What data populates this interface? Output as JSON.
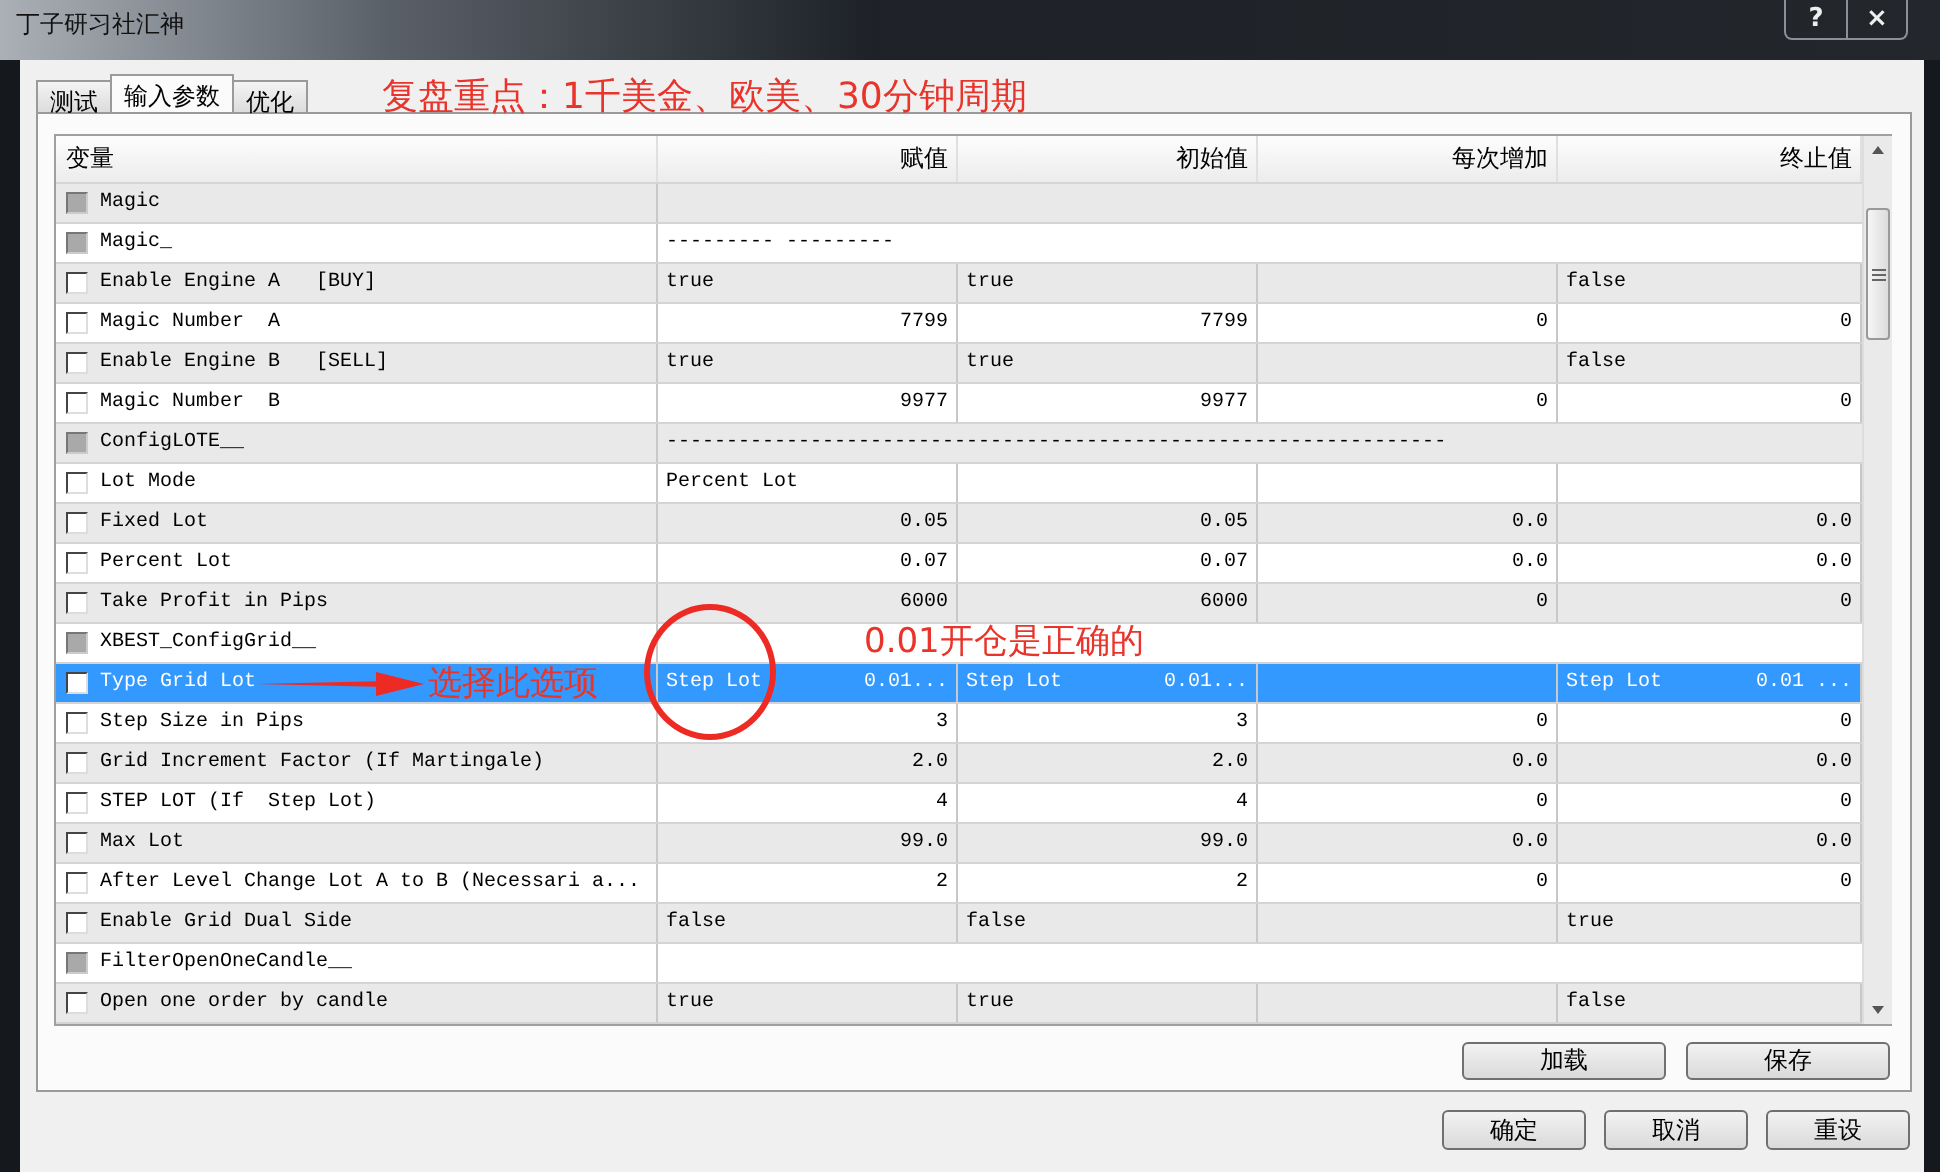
{
  "window": {
    "title": "丁子研习社汇神",
    "buttons": [
      "?",
      "×"
    ]
  },
  "tabs": [
    {
      "label": "测试",
      "selected": false
    },
    {
      "label": "输入参数",
      "selected": true
    },
    {
      "label": "优化",
      "selected": false
    }
  ],
  "annotations": {
    "headline": "复盘重点：1千美金、欧美、30分钟周期",
    "arrow_label": "选择此选项",
    "circle_note": "0.01开仓是正确的"
  },
  "table": {
    "columns": [
      "变量",
      "赋值",
      "初始值",
      "每次增加",
      "终止值"
    ],
    "rows": [
      {
        "kind": "group",
        "name": "Magic",
        "checked": false,
        "disabled": true,
        "selected": false
      },
      {
        "kind": "group",
        "name": "Magic_",
        "value": "--------- ---------",
        "checked": false,
        "disabled": true,
        "selected": false
      },
      {
        "kind": "text",
        "name": "Enable Engine A   [BUY]",
        "checked": false,
        "disabled": false,
        "selected": false,
        "assigned": "true",
        "initial": "true",
        "stop": "false"
      },
      {
        "kind": "number",
        "name": "Magic Number  A",
        "checked": false,
        "disabled": false,
        "selected": false,
        "assigned": "7799",
        "initial": "7799",
        "step": "0",
        "stop": "0"
      },
      {
        "kind": "text",
        "name": "Enable Engine B   [SELL]",
        "checked": false,
        "disabled": false,
        "selected": false,
        "assigned": "true",
        "initial": "true",
        "stop": "false"
      },
      {
        "kind": "number",
        "name": "Magic Number  B",
        "checked": false,
        "disabled": false,
        "selected": false,
        "assigned": "9977",
        "initial": "9977",
        "step": "0",
        "stop": "0"
      },
      {
        "kind": "group",
        "name": "ConfigLOTE__",
        "value": "-----------------------------------------------------------------",
        "checked": false,
        "disabled": true,
        "selected": false
      },
      {
        "kind": "text",
        "name": "Lot Mode",
        "checked": false,
        "disabled": false,
        "selected": false,
        "assigned": "Percent Lot"
      },
      {
        "kind": "number",
        "name": "Fixed Lot",
        "checked": false,
        "disabled": false,
        "selected": false,
        "assigned": "0.05",
        "initial": "0.05",
        "step": "0.0",
        "stop": "0.0"
      },
      {
        "kind": "number",
        "name": "Percent Lot",
        "checked": false,
        "disabled": false,
        "selected": false,
        "assigned": "0.07",
        "initial": "0.07",
        "step": "0.0",
        "stop": "0.0"
      },
      {
        "kind": "number",
        "name": "Take Profit in Pips",
        "checked": false,
        "disabled": false,
        "selected": false,
        "assigned": "6000",
        "initial": "6000",
        "step": "0",
        "stop": "0"
      },
      {
        "kind": "group",
        "name": "XBEST_ConfigGrid__",
        "checked": false,
        "disabled": true,
        "selected": false
      },
      {
        "kind": "list",
        "name": "Type Grid Lot",
        "checked": false,
        "disabled": false,
        "selected": true,
        "assigned": {
          "text": "Step Lot",
          "extra": "0.01..."
        },
        "initial": {
          "text": "Step Lot",
          "extra": "0.01..."
        },
        "stop": {
          "text": "Step Lot",
          "extra": "0.01 ..."
        }
      },
      {
        "kind": "number",
        "name": "Step Size in Pips",
        "checked": false,
        "disabled": false,
        "selected": false,
        "assigned": "3",
        "initial": "3",
        "step": "0",
        "stop": "0"
      },
      {
        "kind": "number",
        "name": "Grid Increment Factor (If Martingale)",
        "checked": false,
        "disabled": false,
        "selected": false,
        "assigned": "2.0",
        "initial": "2.0",
        "step": "0.0",
        "stop": "0.0"
      },
      {
        "kind": "number",
        "name": "STEP LOT (If  Step Lot)",
        "checked": false,
        "disabled": false,
        "selected": false,
        "assigned": "4",
        "initial": "4",
        "step": "0",
        "stop": "0"
      },
      {
        "kind": "number",
        "name": "Max Lot",
        "checked": false,
        "disabled": false,
        "selected": false,
        "assigned": "99.0",
        "initial": "99.0",
        "step": "0.0",
        "stop": "0.0"
      },
      {
        "kind": "number",
        "name": "After Level Change Lot A to B (Necessari a...",
        "checked": false,
        "disabled": false,
        "selected": false,
        "assigned": "2",
        "initial": "2",
        "step": "0",
        "stop": "0"
      },
      {
        "kind": "text",
        "name": "Enable Grid Dual Side",
        "checked": false,
        "disabled": false,
        "selected": false,
        "assigned": "false",
        "initial": "false",
        "stop": "true"
      },
      {
        "kind": "group",
        "name": "FilterOpenOneCandle__",
        "checked": false,
        "disabled": true,
        "selected": false
      },
      {
        "kind": "text",
        "name": "Open one order by candle",
        "checked": false,
        "disabled": false,
        "selected": false,
        "assigned": "true",
        "initial": "true",
        "stop": "false"
      }
    ]
  },
  "panel_buttons": [
    "加载",
    "保存"
  ],
  "buttons": [
    "确定",
    "取消",
    "重设"
  ]
}
